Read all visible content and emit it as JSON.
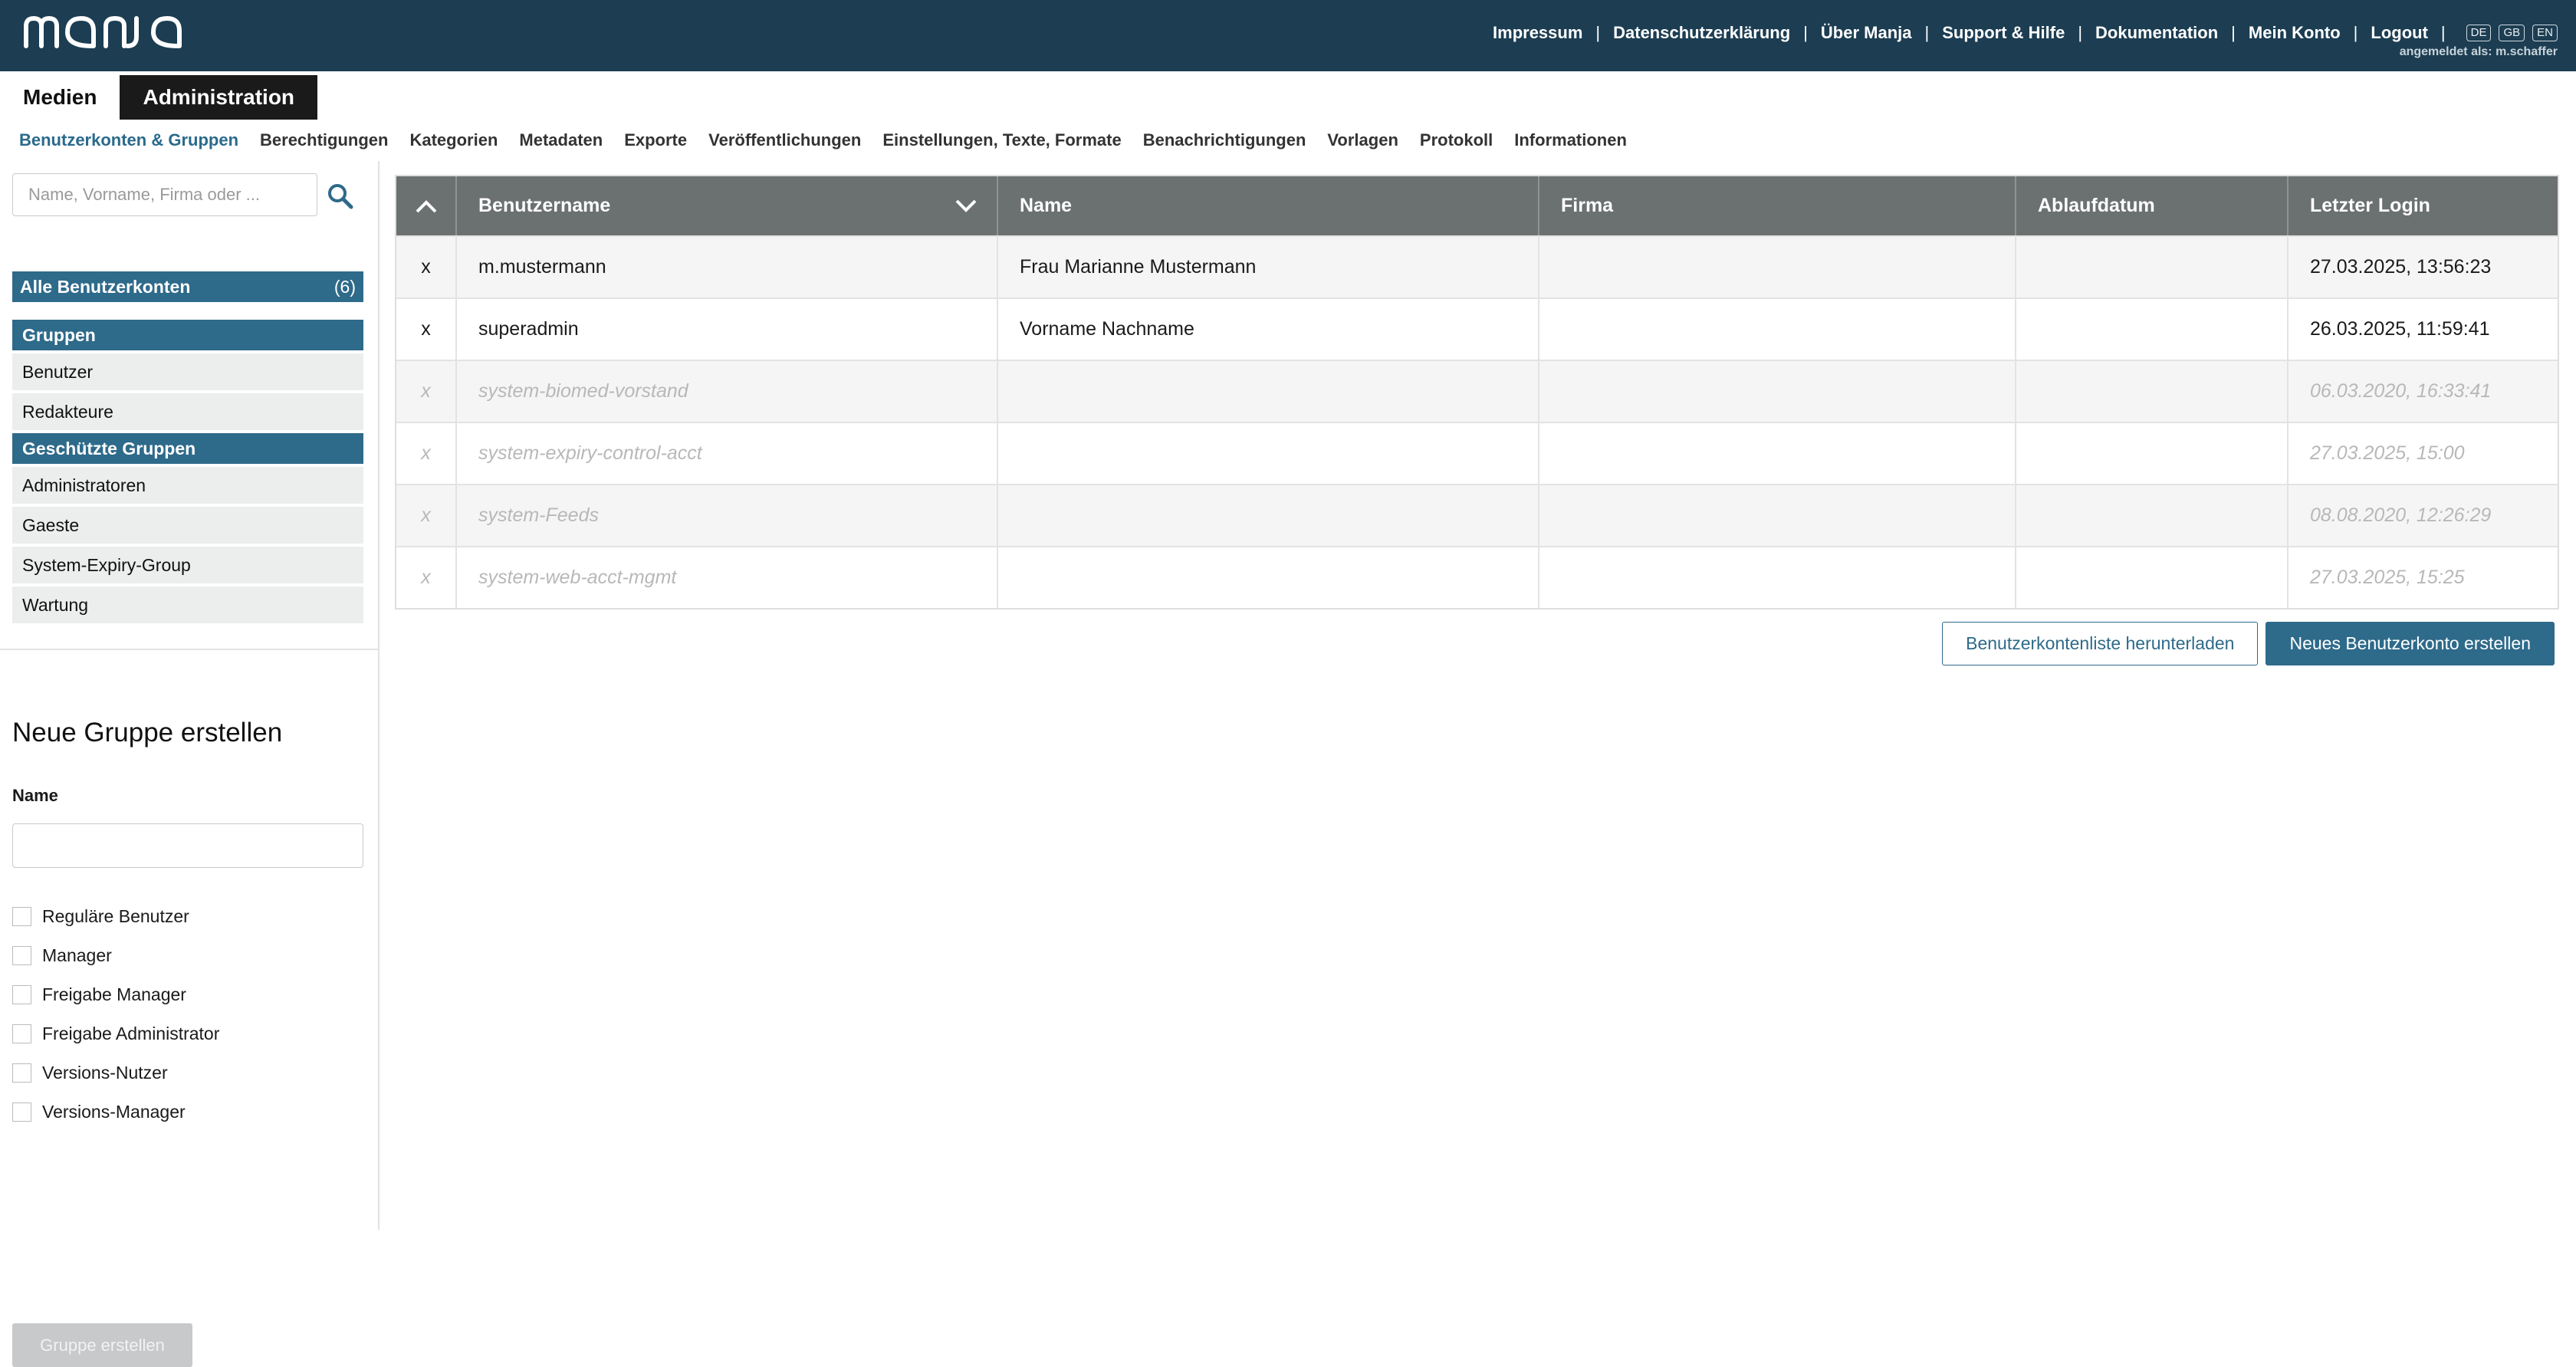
{
  "header": {
    "logo": "manja",
    "nav": [
      "Impressum",
      "Datenschutzerklärung",
      "Über Manja",
      "Support & Hilfe",
      "Dokumentation",
      "Mein Konto",
      "Logout"
    ],
    "languages": [
      "DE",
      "GB",
      "EN"
    ],
    "logged_in": "angemeldet als: m.schaffer"
  },
  "modules": {
    "medien": "Medien",
    "administration": "Administration"
  },
  "subnav": [
    "Benutzerkonten & Gruppen",
    "Berechtigungen",
    "Kategorien",
    "Metadaten",
    "Exporte",
    "Veröffentlichungen",
    "Einstellungen, Texte, Formate",
    "Benachrichtigungen",
    "Vorlagen",
    "Protokoll",
    "Informationen"
  ],
  "sidebar": {
    "search_placeholder": "Name, Vorname, Firma oder ...",
    "all_accounts": {
      "label": "Alle Benutzerkonten",
      "count": "(6)"
    },
    "groups_header": "Gruppen",
    "groups": [
      "Benutzer",
      "Redakteure"
    ],
    "protected_header": "Geschützte Gruppen",
    "protected_groups": [
      "Administratoren",
      "Gaeste",
      "System-Expiry-Group",
      "Wartung"
    ],
    "new_group": {
      "title": "Neue Gruppe erstellen",
      "name_label": "Name",
      "roles": [
        "Reguläre Benutzer",
        "Manager",
        "Freigabe Manager",
        "Freigabe Administrator",
        "Versions-Nutzer",
        "Versions-Manager"
      ],
      "create_button": "Gruppe erstellen"
    }
  },
  "table": {
    "columns": [
      "Benutzername",
      "Name",
      "Firma",
      "Ablaufdatum",
      "Letzter Login"
    ],
    "rows": [
      {
        "x": "x",
        "username": "m.mustermann",
        "name": "Frau Marianne Mustermann",
        "firma": "",
        "ablauf": "",
        "login": "27.03.2025, 13:56:23",
        "system": false
      },
      {
        "x": "x",
        "username": "superadmin",
        "name": "Vorname Nachname",
        "firma": "",
        "ablauf": "",
        "login": "26.03.2025, 11:59:41",
        "system": false
      },
      {
        "x": "x",
        "username": "system-biomed-vorstand",
        "name": "",
        "firma": "",
        "ablauf": "",
        "login": "06.03.2020, 16:33:41",
        "system": true
      },
      {
        "x": "x",
        "username": "system-expiry-control-acct",
        "name": "",
        "firma": "",
        "ablauf": "",
        "login": "27.03.2025, 15:00",
        "system": true
      },
      {
        "x": "x",
        "username": "system-Feeds",
        "name": "",
        "firma": "",
        "ablauf": "",
        "login": "08.08.2020, 12:26:29",
        "system": true
      },
      {
        "x": "x",
        "username": "system-web-acct-mgmt",
        "name": "",
        "firma": "",
        "ablauf": "",
        "login": "27.03.2025, 15:25",
        "system": true
      }
    ]
  },
  "actions": {
    "download": "Benutzerkontenliste herunterladen",
    "create": "Neues Benutzerkonto erstellen"
  },
  "colors": {
    "header_bg": "#1c3d52",
    "accent": "#2e6a8a",
    "table_header": "#6b7071"
  }
}
